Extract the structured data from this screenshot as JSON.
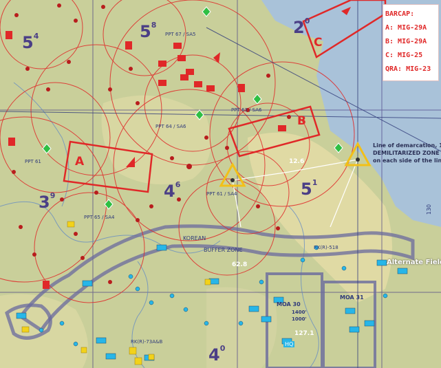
{
  "legend": {
    "title": "BARCAP:",
    "entries": [
      "A: MIG-29A",
      "B: MIG-29A",
      "C: MIG-25",
      "QRA: MIG-23"
    ]
  },
  "cap_zones": [
    "A",
    "B",
    "C"
  ],
  "grid_numbers": [
    {
      "main": "5",
      "sup": "4"
    },
    {
      "main": "5",
      "sup": "8"
    },
    {
      "main": "2",
      "sup": "0"
    },
    {
      "main": "3",
      "sup": "9"
    },
    {
      "main": "4",
      "sup": "6"
    },
    {
      "main": "5",
      "sup": "1"
    },
    {
      "main": "4",
      "sup": "0"
    }
  ],
  "dmz_notice": [
    "Line of demarcation, 1",
    "DEMILITARIZED ZONE ex",
    "on each side of the lin"
  ],
  "map_labels": {
    "buffer_top": "KOREAN",
    "buffer_bottom": "BUFFER  ZONE",
    "elev_1": "12.6",
    "elev_2": "62.8",
    "alternate_field": "Alternate Field",
    "moa_30": "MOA 30",
    "moa_31": "MOA 31",
    "moa_30_alt": "1400'",
    "moa_30_alt2": "1000'",
    "ppt_1": "PPT 67 / SA5",
    "ppt_2": "PPT 64 / SA6",
    "ppt_3": "PPT 61 / SA4",
    "ppt_4": "PPT 63 / SA6",
    "ppt_5": "PPT 61",
    "ppt_6": "PPT 65 / SA4",
    "ppt_7": "RK(R)-73A&B",
    "ppt_8": "RK(R)-518",
    "num_127": "127.1",
    "hq": "HQ",
    "num_130": "130"
  },
  "colors": {
    "threat_red": "#e02828",
    "sam_yellow": "#f2c018",
    "friendly_cyan": "#27b6e8",
    "boundary_purple": "#6a6a9e",
    "terrain_green": "#c9cf9a",
    "sea_blue": "#a9c2d9"
  }
}
